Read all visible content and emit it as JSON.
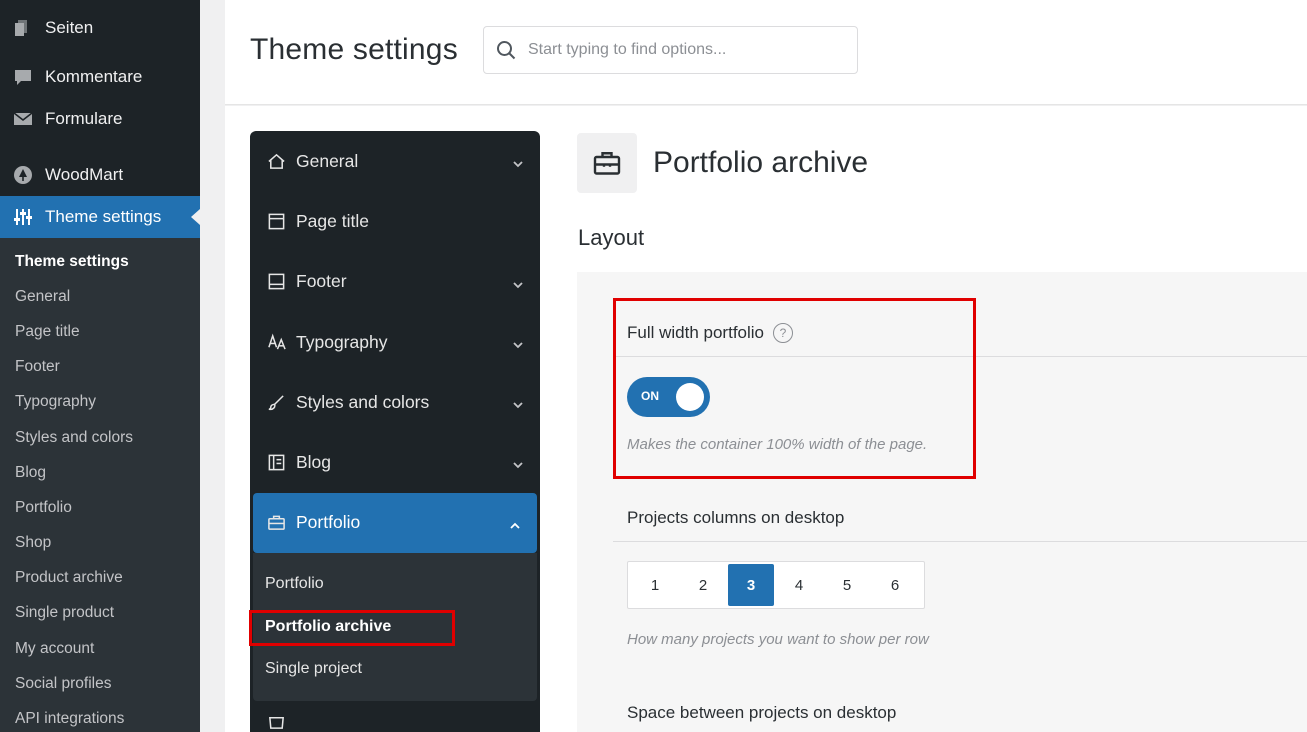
{
  "wp_menu": {
    "items": [
      {
        "label": "Seiten",
        "icon": "pages-icon"
      },
      {
        "label": "Kommentare",
        "icon": "comments-icon"
      },
      {
        "label": "Formulare",
        "icon": "mail-icon"
      }
    ],
    "woodmart": {
      "label": "WoodMart",
      "icon": "tree-icon"
    },
    "theme_settings": {
      "label": "Theme settings",
      "icon": "sliders-icon"
    },
    "submenu": [
      {
        "label": "Theme settings",
        "current": true
      },
      {
        "label": "General"
      },
      {
        "label": "Page title"
      },
      {
        "label": "Footer"
      },
      {
        "label": "Typography"
      },
      {
        "label": "Styles and colors"
      },
      {
        "label": "Blog"
      },
      {
        "label": "Portfolio"
      },
      {
        "label": "Shop"
      },
      {
        "label": "Product archive"
      },
      {
        "label": "Single product"
      },
      {
        "label": "My account"
      },
      {
        "label": "Social profiles"
      },
      {
        "label": "API integrations"
      }
    ]
  },
  "header": {
    "title": "Theme settings",
    "search_placeholder": "Start typing to find options..."
  },
  "ts_nav": {
    "items": [
      {
        "label": "General",
        "icon": "home-icon"
      },
      {
        "label": "Page title",
        "icon": "page-title-icon"
      },
      {
        "label": "Footer",
        "icon": "footer-icon"
      },
      {
        "label": "Typography",
        "icon": "typography-icon"
      },
      {
        "label": "Styles and colors",
        "icon": "brush-icon"
      },
      {
        "label": "Blog",
        "icon": "blog-icon"
      }
    ],
    "active": {
      "label": "Portfolio",
      "icon": "briefcase-icon"
    },
    "sub": [
      {
        "label": "Portfolio"
      },
      {
        "label": "Portfolio archive",
        "current": true
      },
      {
        "label": "Single project"
      }
    ]
  },
  "section": {
    "title": "Portfolio archive",
    "icon": "briefcase-icon",
    "group": "Layout"
  },
  "options": {
    "full_width": {
      "title": "Full width portfolio",
      "help": "?",
      "toggle_label": "ON",
      "toggle_on": true,
      "description": "Makes the container 100% width of the page."
    },
    "columns": {
      "title": "Projects columns on desktop",
      "values": [
        "1",
        "2",
        "3",
        "4",
        "5",
        "6"
      ],
      "selected": "3",
      "description": "How many projects you want to show per row"
    },
    "spacing": {
      "title": "Space between projects on desktop"
    }
  },
  "colors": {
    "accent": "#2271b1",
    "sidebar_bg": "#1d2327",
    "highlight": "#e00000"
  }
}
